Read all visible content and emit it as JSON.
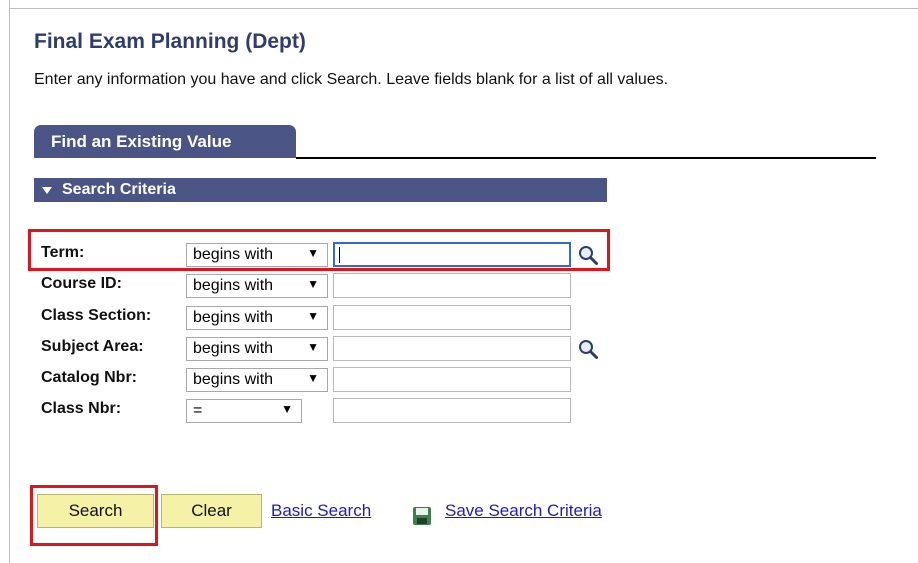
{
  "page": {
    "title": "Final Exam Planning (Dept)",
    "instructions": "Enter any information you have and click Search. Leave fields blank for a list of all values."
  },
  "tab": {
    "label": "Find an Existing Value"
  },
  "section": {
    "label": "Search Criteria",
    "icon": "triangle-down-icon"
  },
  "criteria": [
    {
      "label": "Term:",
      "operator": "begins with",
      "value": "",
      "lookup": true,
      "focused": true
    },
    {
      "label": "Course ID:",
      "operator": "begins with",
      "value": "",
      "lookup": false
    },
    {
      "label": "Class Section:",
      "operator": "begins with",
      "value": "",
      "lookup": false
    },
    {
      "label": "Subject Area:",
      "operator": "begins with",
      "value": "",
      "lookup": true
    },
    {
      "label": "Catalog Nbr:",
      "operator": "begins with",
      "value": "",
      "lookup": false
    },
    {
      "label": "Class Nbr:",
      "operator": "=",
      "value": "",
      "lookup": false
    }
  ],
  "buttons": {
    "search": "Search",
    "clear": "Clear"
  },
  "links": {
    "basic_search": "Basic Search",
    "save_search": "Save Search Criteria"
  },
  "colors": {
    "header_bar": "#4a5485",
    "title": "#2f3c6e",
    "button": "#f5f1a6",
    "highlight": "#e1131b",
    "link": "#1a1acb"
  }
}
